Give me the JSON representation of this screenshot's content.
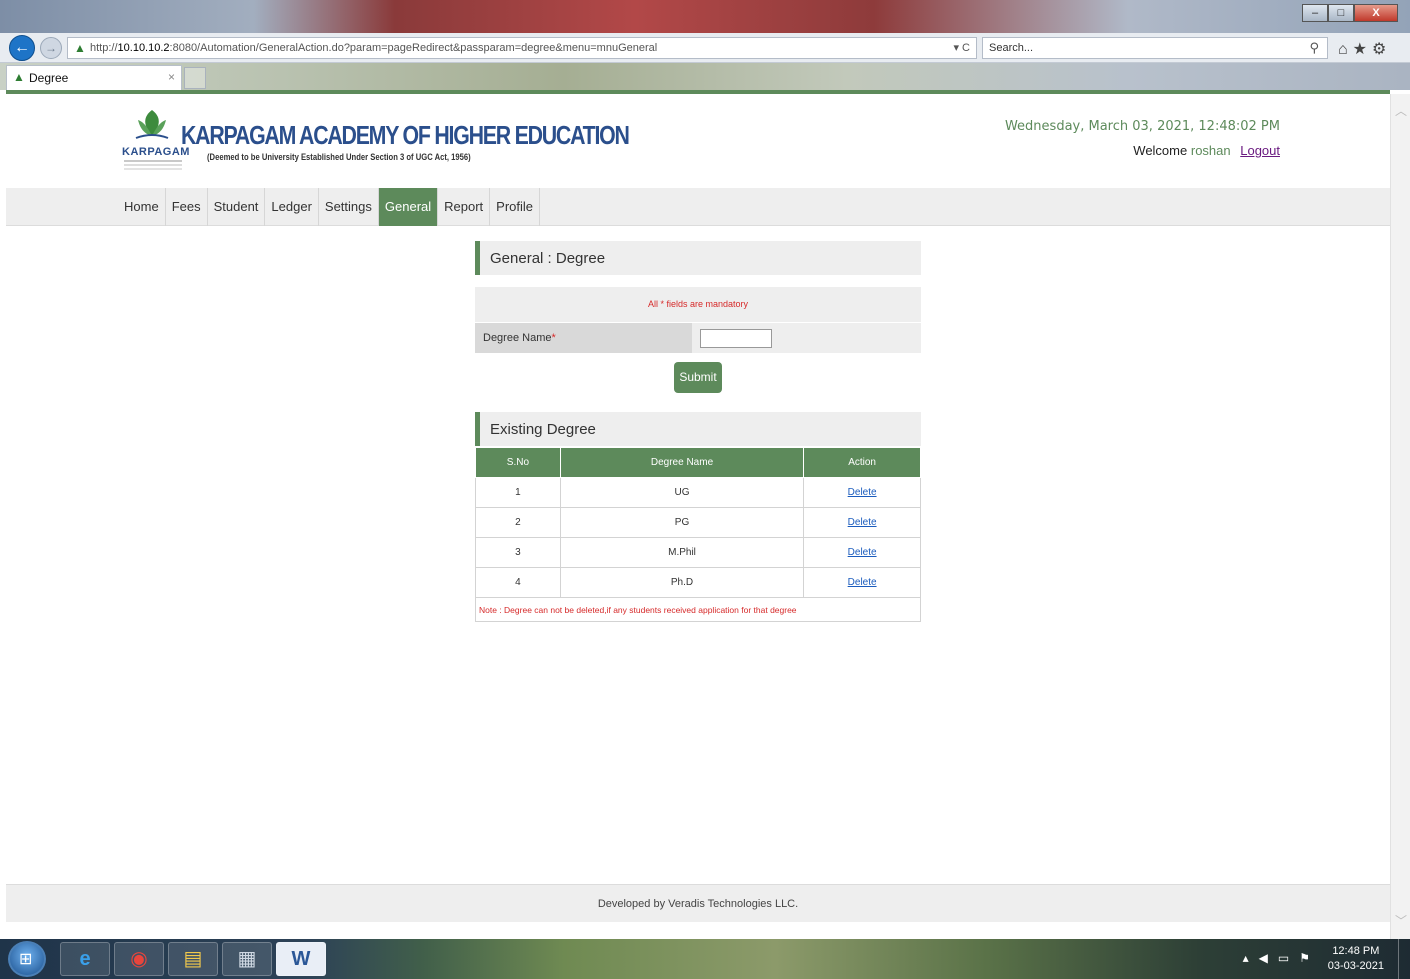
{
  "browser": {
    "url_prefix": "http://",
    "url_host": "10.10.10.2",
    "url_rest": ":8080/Automation/GeneralAction.do?param=pageRedirect&passparam=degree&menu=mnuGeneral",
    "url_actions": "▾ C",
    "search_placeholder": "Search...",
    "tab_title": "Degree",
    "tab_close": "×"
  },
  "header": {
    "logo_text": "KARPAGAM",
    "institution_name": "KARPAGAM ACADEMY OF HIGHER EDUCATION",
    "institution_sub": "(Deemed to be University Established Under Section 3 of UGC Act, 1956)",
    "datetime": "Wednesday, March 03, 2021, 12:48:02 PM",
    "welcome": "Welcome",
    "username": "roshan",
    "logout": "Logout"
  },
  "menu": [
    "Home",
    "Fees",
    "Student",
    "Ledger",
    "Settings",
    "General",
    "Report",
    "Profile"
  ],
  "menu_active": "General",
  "form": {
    "section_title": "General : Degree",
    "mandatory_note": "All * fields are mandatory",
    "degree_label": "Degree Name",
    "required_mark": "*",
    "degree_value": "",
    "submit_label": "Submit"
  },
  "existing": {
    "section_title": "Existing Degree",
    "columns": [
      "S.No",
      "Degree Name",
      "Action"
    ],
    "rows": [
      {
        "sno": "1",
        "name": "UG",
        "action": "Delete"
      },
      {
        "sno": "2",
        "name": "PG",
        "action": "Delete"
      },
      {
        "sno": "3",
        "name": "M.Phil",
        "action": "Delete"
      },
      {
        "sno": "4",
        "name": "Ph.D",
        "action": "Delete"
      }
    ],
    "note": "Note : Degree can not be deleted,if any students received application for that degree"
  },
  "footer": {
    "text": "Developed by Veradis Technologies LLC."
  },
  "taskbar": {
    "time": "12:48 PM",
    "date": "03-03-2021"
  },
  "colors": {
    "accent": "#5d8a5b",
    "brand_blue": "#2b4f8c",
    "required_red": "#d62a2a",
    "link_blue": "#1a5bbd"
  }
}
